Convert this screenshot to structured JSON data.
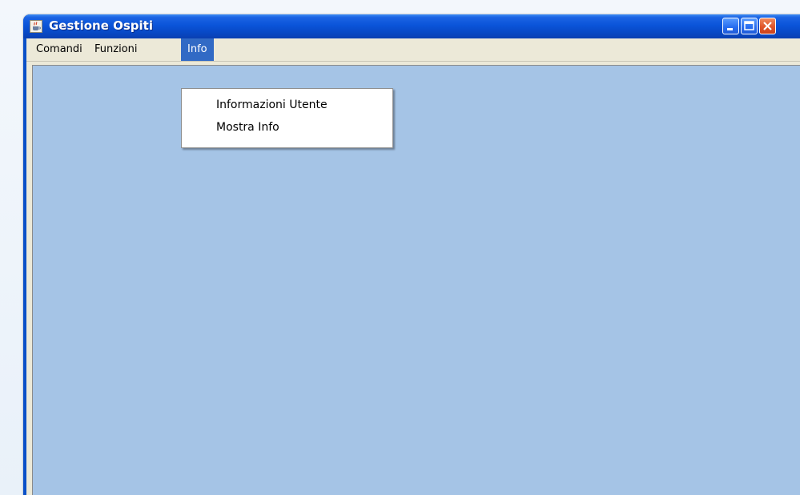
{
  "window": {
    "title": "Gestione Ospiti",
    "icon": "java-cup-icon",
    "controls": {
      "minimize_icon": "minimize-icon",
      "maximize_icon": "maximize-icon",
      "close_icon": "close-icon"
    }
  },
  "menubar": {
    "items": [
      {
        "label": "Comandi"
      },
      {
        "label": "Funzioni"
      },
      {
        "label": "Info",
        "state": "open"
      }
    ]
  },
  "dropdown": {
    "parent": "Info",
    "items": [
      {
        "label": "Informazioni Utente"
      },
      {
        "label": "Mostra Info"
      }
    ]
  },
  "colors": {
    "titlebar": "#0a54d9",
    "menubar": "#ece9d8",
    "menu_highlight": "#316ac5",
    "desktop_pane": "#a5c4e6",
    "dropdown_bg": "#ffffff"
  }
}
